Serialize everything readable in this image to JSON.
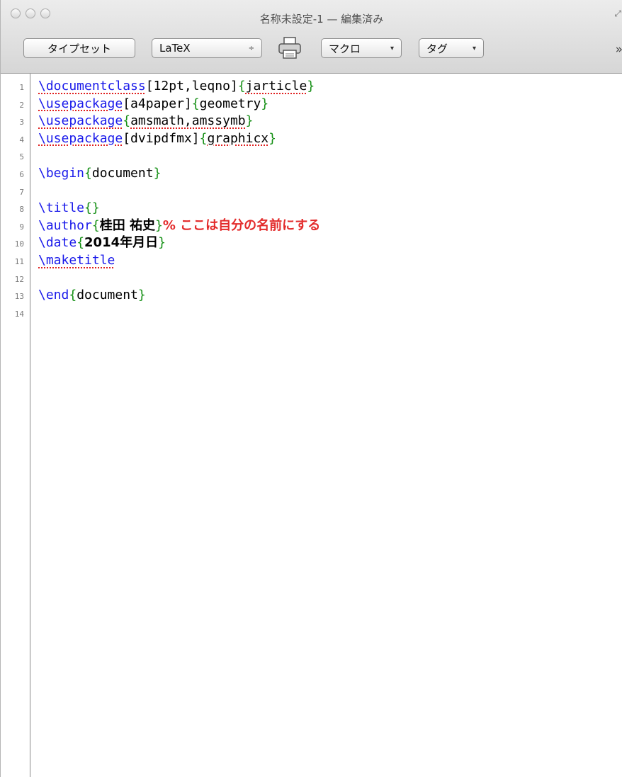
{
  "window": {
    "title": "名称未設定-1 — 編集済み"
  },
  "toolbar": {
    "typeset_label": "タイプセット",
    "engine_value": "LaTeX",
    "engine_arrow": "÷",
    "macro_label": "マクロ",
    "tag_label": "タグ",
    "dropdown_arrow": "▾",
    "more_glyph": "»",
    "icons": [
      "print-icon",
      "fullscreen-icon",
      "more-icon"
    ]
  },
  "editor": {
    "line_numbers": [
      "1",
      "2",
      "3",
      "4",
      "5",
      "6",
      "7",
      "8",
      "9",
      "10",
      "11",
      "12",
      "13",
      "14"
    ],
    "lines": [
      {
        "cmd": "\\documentclass",
        "opt": "[12pt,leqno]",
        "lb": "{",
        "arg": "jarticle",
        "rb": "}"
      },
      {
        "cmd": "\\usepackage",
        "opt": "[a4paper]",
        "lb": "{",
        "arg": "geometry",
        "rb": "}"
      },
      {
        "cmd": "\\usepackage",
        "lb": "{",
        "arg": "amsmath,amssymb",
        "rb": "}"
      },
      {
        "cmd": "\\usepackage",
        "opt": "[dvipdfmx]",
        "lb": "{",
        "arg": "graphicx",
        "rb": "}"
      },
      {},
      {
        "cmd": "\\begin",
        "lb": "{",
        "arg": "document",
        "rb": "}"
      },
      {},
      {
        "cmd": "\\title",
        "lb": "{",
        "rb": "}"
      },
      {
        "cmd": "\\author",
        "lb": "{",
        "arg": "桂田 祐史",
        "rb": "}",
        "comment": "% ここは自分の名前にする"
      },
      {
        "cmd": "\\date",
        "lb": "{",
        "arg": "2014年月日",
        "rb": "}"
      },
      {
        "cmd": "\\maketitle"
      },
      {},
      {
        "cmd": "\\end",
        "lb": "{",
        "arg": "document",
        "rb": "}"
      },
      {}
    ]
  },
  "colors": {
    "command": "#1a1aea",
    "brace": "#169016",
    "comment": "#e32b2b",
    "spell_underline": "#e02020"
  }
}
